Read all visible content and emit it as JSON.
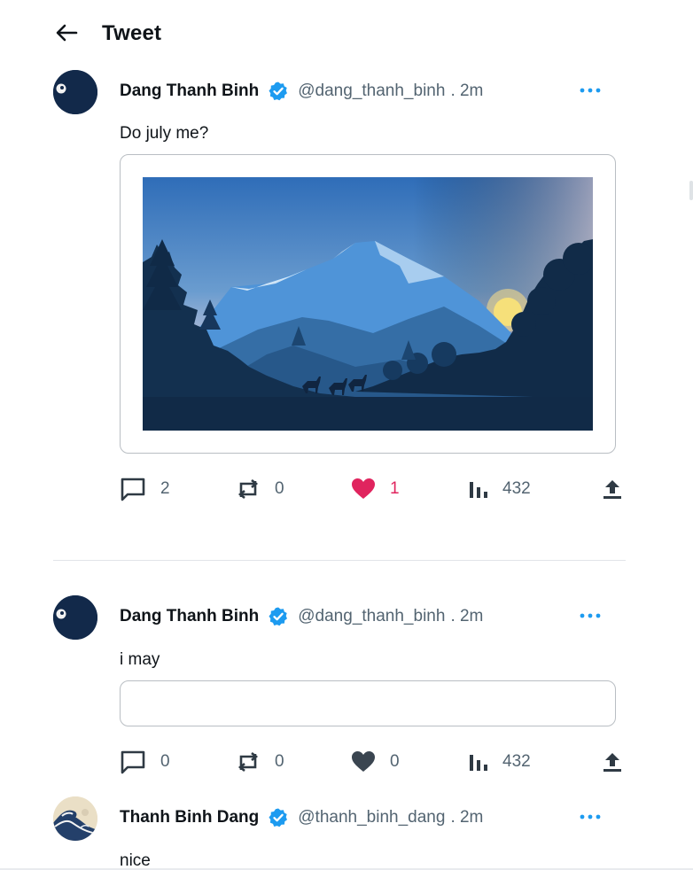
{
  "header": {
    "title": "Tweet"
  },
  "tweets": [
    {
      "author": {
        "name": "Dang Thanh Binh",
        "handle": "@dang_thanh_binh",
        "time": ". 2m"
      },
      "text": "Do july me?",
      "has_image": true,
      "stats": {
        "replies": "2",
        "retweets": "0",
        "likes": "1",
        "views": "432"
      },
      "liked": true
    },
    {
      "author": {
        "name": "Dang Thanh Binh",
        "handle": "@dang_thanh_binh",
        "time": ". 2m"
      },
      "text": "i may",
      "has_image": false,
      "stats": {
        "replies": "0",
        "retweets": "0",
        "likes": "0",
        "views": "432"
      },
      "liked": false
    },
    {
      "author": {
        "name": "Thanh Binh Dang",
        "handle": "@thanh_binh_dang",
        "time": ". 2m"
      },
      "text": "nice"
    }
  ],
  "colors": {
    "accent": "#1d9bf0",
    "like": "#e0245e",
    "text_secondary": "#536471",
    "border": "#b9bec3",
    "verified": "#1d9bf0"
  },
  "icons": {
    "back": "arrow-left-icon",
    "verified": "verified-badge-icon",
    "more": "more-dots-icon",
    "reply": "reply-icon",
    "retweet": "retweet-icon",
    "like": "heart-icon",
    "views": "views-bar-chart-icon",
    "share": "share-upload-icon"
  }
}
